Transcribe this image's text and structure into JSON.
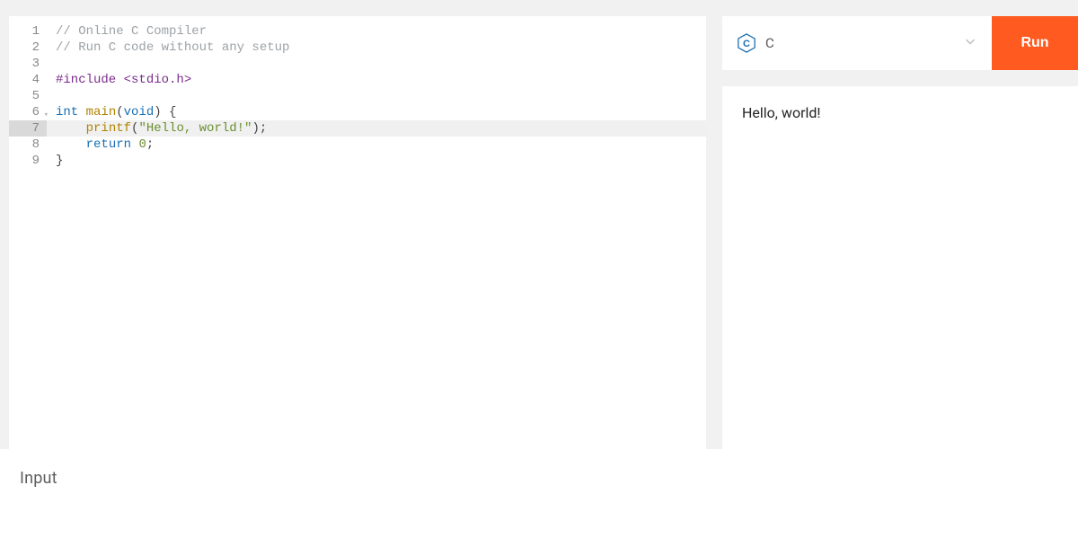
{
  "editor": {
    "highlighted_line": 7,
    "fold_line": 6,
    "lines": [
      {
        "n": 1,
        "tokens": [
          {
            "t": "// Online C Compiler",
            "c": "tok-comment"
          }
        ]
      },
      {
        "n": 2,
        "tokens": [
          {
            "t": "// Run C code without any setup",
            "c": "tok-comment"
          }
        ]
      },
      {
        "n": 3,
        "tokens": []
      },
      {
        "n": 4,
        "tokens": [
          {
            "t": "#include",
            "c": "tok-pre"
          },
          {
            "t": " ",
            "c": ""
          },
          {
            "t": "<stdio.h>",
            "c": "tok-pre"
          }
        ]
      },
      {
        "n": 5,
        "tokens": []
      },
      {
        "n": 6,
        "tokens": [
          {
            "t": "int",
            "c": "tok-kw"
          },
          {
            "t": " ",
            "c": ""
          },
          {
            "t": "main",
            "c": "tok-fn"
          },
          {
            "t": "(",
            "c": "tok-punct"
          },
          {
            "t": "void",
            "c": "tok-kw"
          },
          {
            "t": ") {",
            "c": "tok-punct"
          }
        ]
      },
      {
        "n": 7,
        "tokens": [
          {
            "t": "    ",
            "c": ""
          },
          {
            "t": "printf",
            "c": "tok-fn"
          },
          {
            "t": "(",
            "c": "tok-punct"
          },
          {
            "t": "\"Hello, world!\"",
            "c": "tok-str"
          },
          {
            "t": ");",
            "c": "tok-punct"
          }
        ]
      },
      {
        "n": 8,
        "tokens": [
          {
            "t": "    ",
            "c": ""
          },
          {
            "t": "return",
            "c": "tok-kw"
          },
          {
            "t": " ",
            "c": ""
          },
          {
            "t": "0",
            "c": "tok-num"
          },
          {
            "t": ";",
            "c": "tok-punct"
          }
        ]
      },
      {
        "n": 9,
        "tokens": [
          {
            "t": "}",
            "c": "tok-punct"
          }
        ]
      }
    ]
  },
  "language": {
    "name": "C",
    "icon_letter": "C",
    "icon_color": "#1a6fb3"
  },
  "run_label": "Run",
  "output": "Hello, world!",
  "input_label": "Input"
}
